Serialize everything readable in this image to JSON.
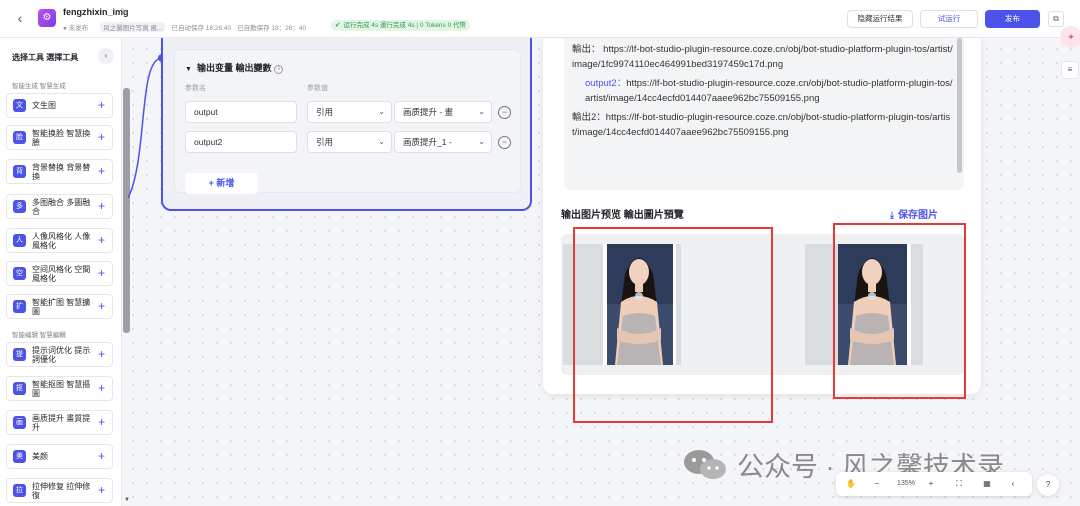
{
  "header": {
    "app_name": "fengzhixin_img",
    "status_unpublished": "未发布",
    "workflow_desc": "风之馨图片写真 風...",
    "autosave_simplified": "已自动保存 18:26:40",
    "autosave_traditional": "已自動保存 18：26：40",
    "run_status": "运行完成 4s 運行完成 4s | 0 Tokens 0 代幣",
    "hide_result_label": "隐藏运行结果",
    "test_run_label": "试运行",
    "publish_label": "发布"
  },
  "sidebar": {
    "title": "选择工具 選擇工具",
    "sections": [
      {
        "label": "智能生成 智慧生成",
        "items": [
          {
            "label": "文生图",
            "icon": "文"
          },
          {
            "label": "智能换脸 智慧換臉",
            "icon": "脸"
          },
          {
            "label": "背景替换 背景替換",
            "icon": "背"
          },
          {
            "label": "多图融合 多圖融合",
            "icon": "多"
          },
          {
            "label": "人像风格化 人像風格化",
            "icon": "人"
          },
          {
            "label": "空间风格化 空間風格化",
            "icon": "空"
          },
          {
            "label": "智能扩图 智慧擴圖",
            "icon": "扩"
          }
        ]
      },
      {
        "label": "智能编辑 智慧編輯",
        "items": [
          {
            "label": "提示词优化 提示詞優化",
            "icon": "提"
          },
          {
            "label": "智能抠图 智慧摳圖",
            "icon": "抠"
          },
          {
            "label": "画质提升 畫質提升",
            "icon": "画"
          },
          {
            "label": "美颜",
            "icon": "美"
          },
          {
            "label": "拉伸修复 拉伸修復",
            "icon": "拉"
          }
        ]
      }
    ]
  },
  "node": {
    "output_header": "输出变量 輸出變數",
    "col_name": "参数名",
    "col_value": "参数值",
    "rows": [
      {
        "name": "output",
        "type": "引用",
        "ref": "画质提升 - 畫"
      },
      {
        "name": "output2",
        "type": "引用",
        "ref": "画质提升_1 - "
      }
    ],
    "add_label": "新增"
  },
  "result": {
    "log_lines": [
      {
        "prefix": "輸出：",
        "text": "https://lf-bot-studio-plugin-resource.coze.cn/obj/bot-studio-platform-plugin-tos/artist/image/1fc9974110ec464991bed3197459c17d.png"
      },
      {
        "prefix": "output2：",
        "text": "https://lf-bot-studio-plugin-resource.coze.cn/obj/bot-studio-platform-plugin-tos/artist/image/14cc4ecfd014407aaee962bc75509155.png"
      },
      {
        "prefix": "輸出2：",
        "text": "https://lf-bot-studio-plugin-resource.coze.cn/obj/bot-studio-platform-plugin-tos/artist/image/14cc4ecfd014407aaee962bc75509155.png"
      }
    ],
    "preview_title": "输出图片预览 輸出圖片預覽",
    "save_image_label": "保存图片"
  },
  "toolbar": {
    "zoom": "135%"
  },
  "watermark": "公众号 · 风之馨技术录",
  "colors": {
    "accent": "#4d53e8",
    "success": "#2f9d48",
    "highlight_box": "#e53935"
  }
}
